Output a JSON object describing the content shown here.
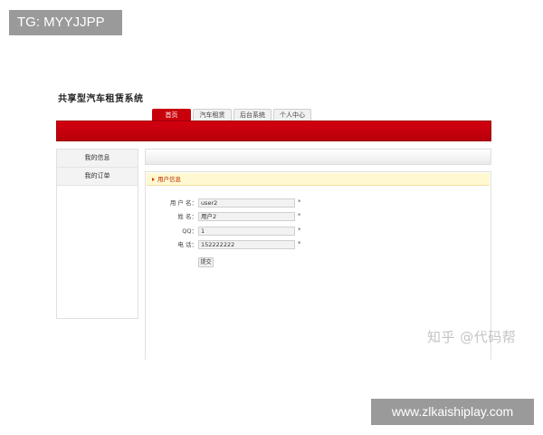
{
  "overlays": {
    "tg_label": "TG: MYYJJPP",
    "site_url": "www.zlkaishiplay.com",
    "watermark": "知乎 @代码帮"
  },
  "app": {
    "title": "共享型汽车租赁系统"
  },
  "nav": {
    "tabs": [
      {
        "label": "首页",
        "active": true
      },
      {
        "label": "汽车租赁",
        "active": false
      },
      {
        "label": "后台系统",
        "active": false
      },
      {
        "label": "个人中心",
        "active": false
      }
    ]
  },
  "sidebar": {
    "items": [
      {
        "label": "我的信息"
      },
      {
        "label": "我的订单"
      }
    ]
  },
  "panel": {
    "header": "用户信息",
    "fields": [
      {
        "label": "用 户 名：",
        "value": "user2",
        "required": "*"
      },
      {
        "label": "姓 名：",
        "value": "用户2",
        "required": "*"
      },
      {
        "label": "QQ：",
        "value": "1",
        "required": "*"
      },
      {
        "label": "电 话：",
        "value": "152222222",
        "required": "*"
      }
    ],
    "submit_label": "提交"
  },
  "colors": {
    "accent_red": "#c8000c",
    "header_yellow": "#fff8d0",
    "overlay_gray": "#9a9a9a"
  }
}
